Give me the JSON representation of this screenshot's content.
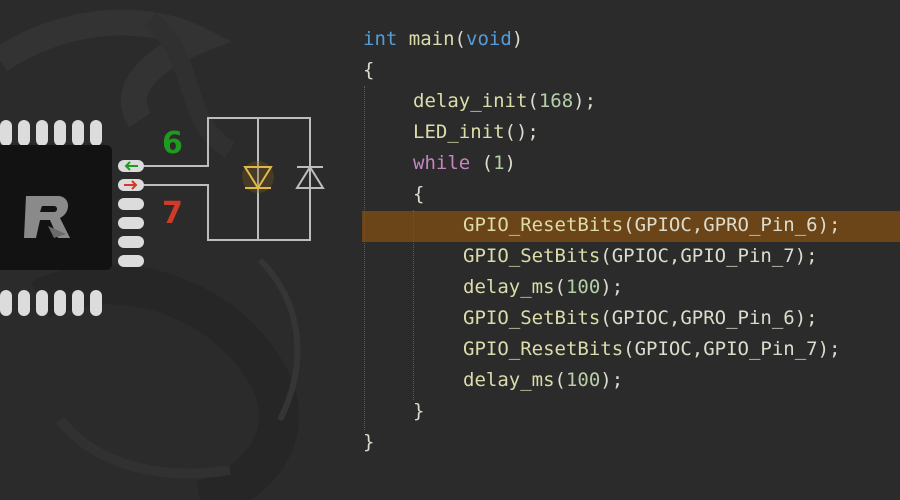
{
  "pins": {
    "input_number": "6",
    "output_number": "7",
    "input_color": "#1f9a1f",
    "output_color": "#d03a28"
  },
  "code": {
    "lines": [
      {
        "indent": 0,
        "tokens": [
          {
            "t": "int",
            "c": "kw"
          },
          {
            "t": " "
          },
          {
            "t": "main",
            "c": "fn"
          },
          {
            "t": "("
          },
          {
            "t": "void",
            "c": "kw"
          },
          {
            "t": ")"
          }
        ]
      },
      {
        "indent": 0,
        "tokens": [
          {
            "t": "{"
          }
        ]
      },
      {
        "indent": 1,
        "tokens": [
          {
            "t": "delay_init",
            "c": "fn"
          },
          {
            "t": "("
          },
          {
            "t": "168",
            "c": "num"
          },
          {
            "t": ");"
          }
        ]
      },
      {
        "indent": 1,
        "tokens": [
          {
            "t": "LED_init",
            "c": "fn"
          },
          {
            "t": "();"
          }
        ]
      },
      {
        "indent": 1,
        "tokens": [
          {
            "t": "while",
            "c": "ctrl"
          },
          {
            "t": " ("
          },
          {
            "t": "1",
            "c": "num"
          },
          {
            "t": ")"
          }
        ]
      },
      {
        "indent": 1,
        "tokens": [
          {
            "t": "{"
          }
        ]
      },
      {
        "indent": 2,
        "tokens": [
          {
            "t": "GPIO_ResetBits",
            "c": "fn"
          },
          {
            "t": "(GPIOC,GPRO_Pin_6);"
          }
        ],
        "highlight": true
      },
      {
        "indent": 2,
        "tokens": [
          {
            "t": "GPIO_SetBits",
            "c": "fn"
          },
          {
            "t": "(GPIOC,GPIO_Pin_7);"
          }
        ]
      },
      {
        "indent": 2,
        "tokens": [
          {
            "t": "delay_ms",
            "c": "fn"
          },
          {
            "t": "("
          },
          {
            "t": "100",
            "c": "num"
          },
          {
            "t": ");"
          }
        ]
      },
      {
        "indent": 2,
        "tokens": [
          {
            "t": "GPIO_SetBits",
            "c": "fn"
          },
          {
            "t": "(GPIOC,GPRO_Pin_6);"
          }
        ]
      },
      {
        "indent": 2,
        "tokens": [
          {
            "t": "GPIO_ResetBits",
            "c": "fn"
          },
          {
            "t": "(GPIOC,GPIO_Pin_7);"
          }
        ]
      },
      {
        "indent": 2,
        "tokens": [
          {
            "t": "delay_ms",
            "c": "fn"
          },
          {
            "t": "("
          },
          {
            "t": "100",
            "c": "num"
          },
          {
            "t": ");"
          }
        ]
      },
      {
        "indent": 1,
        "tokens": [
          {
            "t": "}"
          }
        ]
      },
      {
        "indent": 0,
        "tokens": [
          {
            "t": "}"
          }
        ]
      }
    ],
    "highlight_color": "#6b4417"
  }
}
